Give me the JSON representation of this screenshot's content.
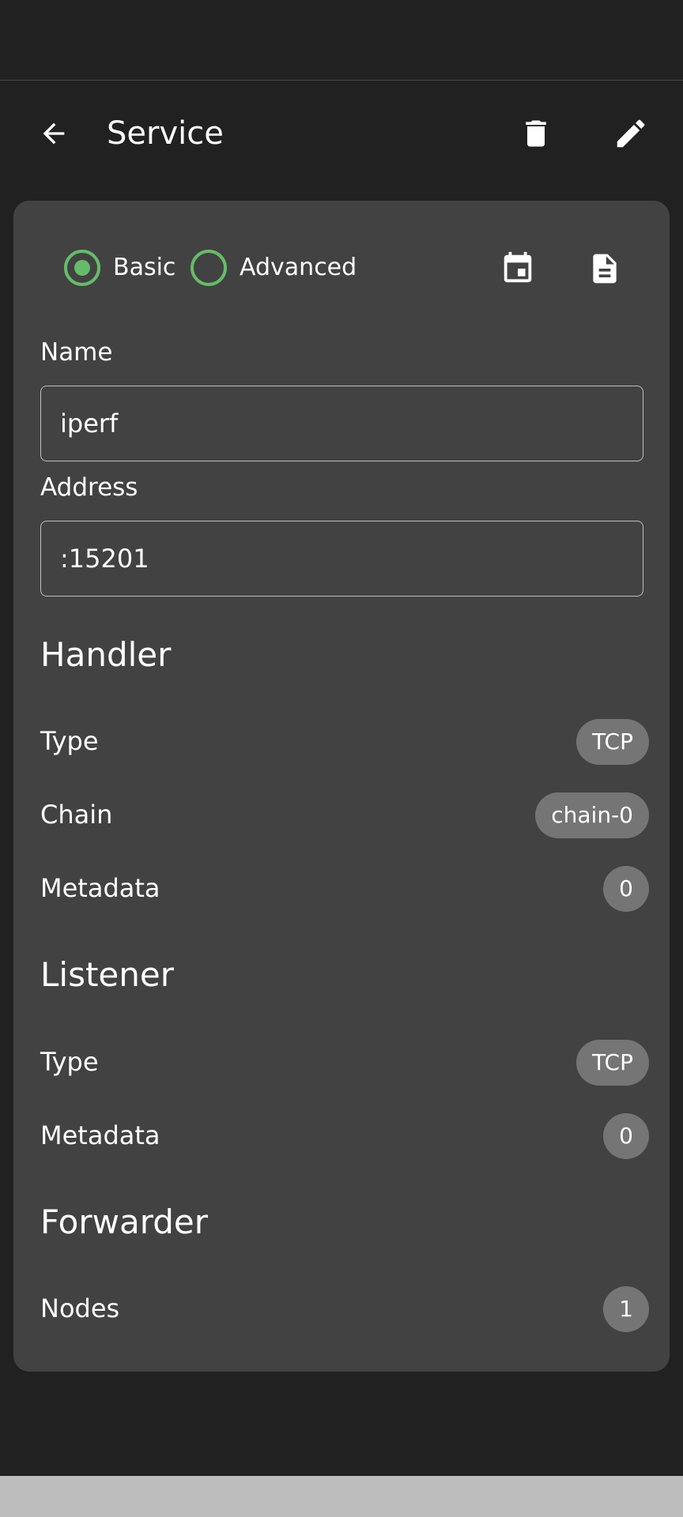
{
  "app_bar": {
    "title": "Service",
    "back_icon": "arrow-back-icon",
    "delete_icon": "trash-icon",
    "edit_icon": "pencil-icon"
  },
  "mode": {
    "options": [
      {
        "label": "Basic",
        "selected": true
      },
      {
        "label": "Advanced",
        "selected": false
      }
    ],
    "accent": "#66bb6a",
    "calendar_icon": "calendar-icon",
    "document_icon": "document-icon"
  },
  "form": {
    "name_label": "Name",
    "name_value": "iperf",
    "address_label": "Address",
    "address_value": ":15201"
  },
  "handler": {
    "title": "Handler",
    "rows": [
      {
        "label": "Type",
        "value": "TCP"
      },
      {
        "label": "Chain",
        "value": "chain-0"
      },
      {
        "label": "Metadata",
        "value": "0"
      }
    ]
  },
  "listener": {
    "title": "Listener",
    "rows": [
      {
        "label": "Type",
        "value": "TCP"
      },
      {
        "label": "Metadata",
        "value": "0"
      }
    ]
  },
  "forwarder": {
    "title": "Forwarder",
    "rows": [
      {
        "label": "Nodes",
        "value": "1"
      }
    ]
  }
}
